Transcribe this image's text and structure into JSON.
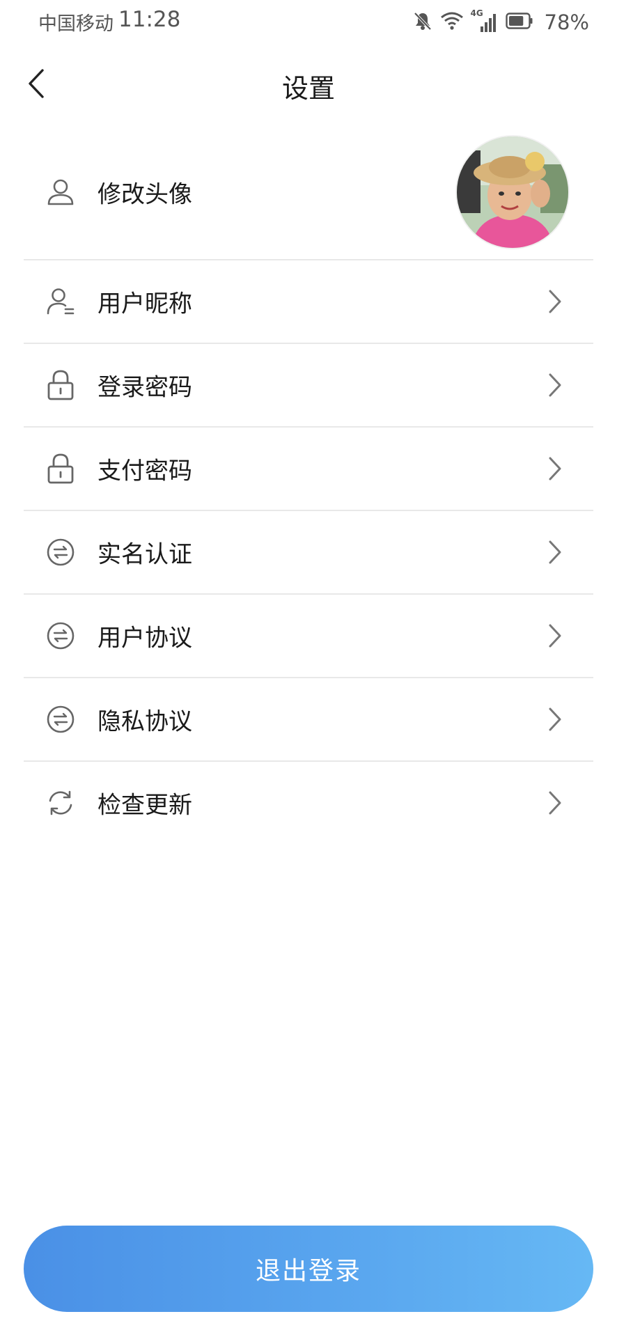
{
  "status_bar": {
    "carrier": "中国移动",
    "time": "11:28",
    "network_label": "4G",
    "battery": "78%",
    "battery_level": 0.78,
    "icons": [
      "bell-muted-icon",
      "wifi-icon",
      "signal-icon",
      "battery-icon"
    ]
  },
  "header": {
    "title": "设置",
    "back_icon": "chevron-left-icon"
  },
  "settings": {
    "avatar_row": {
      "label": "修改头像",
      "icon": "user-icon"
    },
    "items": [
      {
        "label": "用户昵称",
        "icon": "user-edit-icon"
      },
      {
        "label": "登录密码",
        "icon": "lock-icon"
      },
      {
        "label": "支付密码",
        "icon": "lock-icon"
      },
      {
        "label": "实名认证",
        "icon": "exchange-circle-icon"
      },
      {
        "label": "用户协议",
        "icon": "exchange-circle-icon"
      },
      {
        "label": "隐私协议",
        "icon": "exchange-circle-icon"
      },
      {
        "label": "检查更新",
        "icon": "refresh-icon"
      }
    ]
  },
  "logout": {
    "label": "退出登录"
  },
  "colors": {
    "accent_start": "#4a90e6",
    "accent_end": "#66b8f4",
    "divider": "#e8e8e8",
    "icon_gray": "#666666"
  }
}
